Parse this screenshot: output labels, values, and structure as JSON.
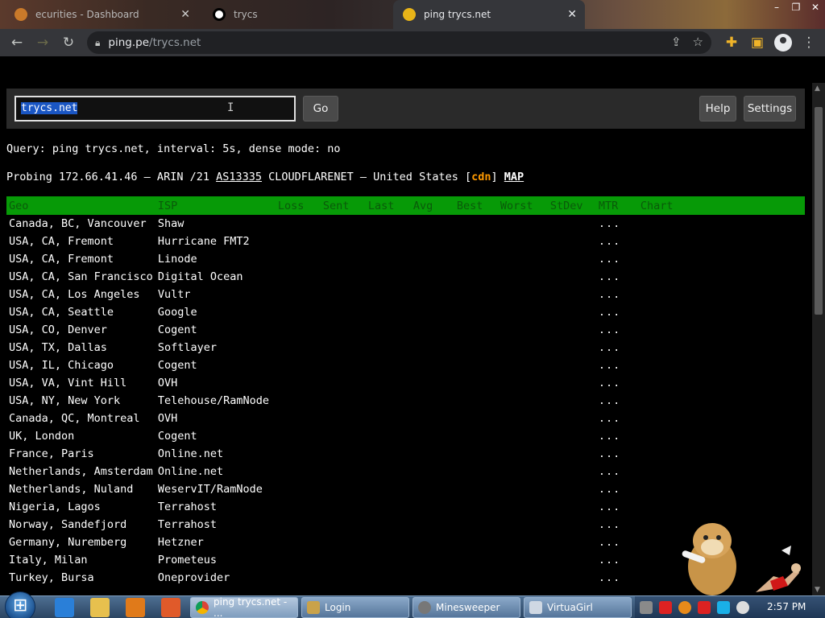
{
  "browser": {
    "tabs": [
      {
        "label": "ecurities - Dashboard",
        "active": false
      },
      {
        "label": "trycs",
        "active": false
      },
      {
        "label": "ping trycs.net",
        "active": true
      }
    ],
    "url_host": "ping.pe",
    "url_path": "/trycs.net"
  },
  "search": {
    "value": "trycs.net",
    "go_label": "Go",
    "help_label": "Help",
    "settings_label": "Settings"
  },
  "query_line": "Query: ping trycs.net, interval: 5s, dense mode: no",
  "probe": {
    "prefix": "Probing 172.66.41.46 – ARIN /21 ",
    "asn": "AS13335",
    "middle": " CLOUDFLARENET – United States [",
    "cdn": "cdn",
    "close": "] ",
    "map": "MAP"
  },
  "table": {
    "headers": [
      "Geo",
      "ISP",
      "Loss",
      "Sent",
      "Last",
      "Avg",
      "Best",
      "Worst",
      "StDev",
      "MTR",
      "Chart"
    ],
    "mtr_placeholder": "...",
    "rows": [
      {
        "geo": "Canada, BC, Vancouver",
        "isp": "Shaw"
      },
      {
        "geo": "USA, CA, Fremont",
        "isp": "Hurricane FMT2"
      },
      {
        "geo": "USA, CA, Fremont",
        "isp": "Linode"
      },
      {
        "geo": "USA, CA, San Francisco",
        "isp": "Digital Ocean"
      },
      {
        "geo": "USA, CA, Los Angeles",
        "isp": "Vultr"
      },
      {
        "geo": "USA, CA, Seattle",
        "isp": "Google"
      },
      {
        "geo": "USA, CO, Denver",
        "isp": "Cogent"
      },
      {
        "geo": "USA, TX, Dallas",
        "isp": "Softlayer"
      },
      {
        "geo": "USA, IL, Chicago",
        "isp": "Cogent"
      },
      {
        "geo": "USA, VA, Vint Hill",
        "isp": "OVH"
      },
      {
        "geo": "USA, NY, New York",
        "isp": "Telehouse/RamNode"
      },
      {
        "geo": "Canada, QC, Montreal",
        "isp": "OVH"
      },
      {
        "geo": "UK, London",
        "isp": "Cogent"
      },
      {
        "geo": "France, Paris",
        "isp": "Online.net"
      },
      {
        "geo": "Netherlands, Amsterdam",
        "isp": "Online.net"
      },
      {
        "geo": "Netherlands, Nuland",
        "isp": "WeservIT/RamNode"
      },
      {
        "geo": "Nigeria, Lagos",
        "isp": "Terrahost"
      },
      {
        "geo": "Norway, Sandefjord",
        "isp": "Terrahost"
      },
      {
        "geo": "Germany, Nuremberg",
        "isp": "Hetzner"
      },
      {
        "geo": "Italy, Milan",
        "isp": "Prometeus"
      },
      {
        "geo": "Turkey, Bursa",
        "isp": "Oneprovider"
      }
    ]
  },
  "taskbar": {
    "items": [
      {
        "label": "ping trycs.net - ...",
        "active": true
      },
      {
        "label": "Login",
        "active": false
      },
      {
        "label": "Minesweeper",
        "active": false
      },
      {
        "label": "VirtuaGirl",
        "active": false
      }
    ],
    "clock": "2:57 PM"
  },
  "colors": {
    "header_green": "#079a07",
    "cdn_orange": "#ff9900",
    "selection_blue": "#1a56c4"
  }
}
